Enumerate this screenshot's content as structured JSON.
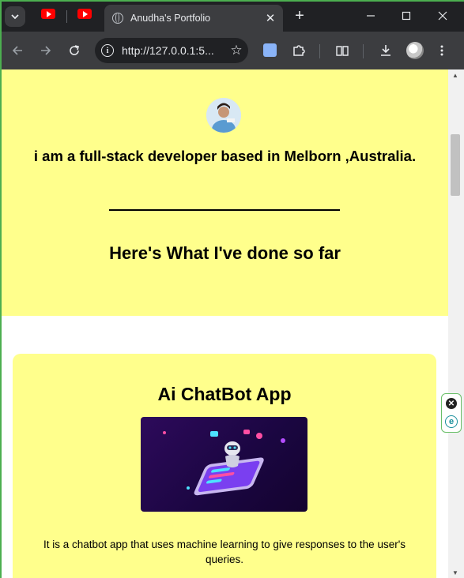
{
  "browser": {
    "active_tab_title": "Anudha's Portfolio",
    "address_url": "http://127.0.0.1:5...",
    "new_tab_symbol": "+",
    "close_symbol": "✕"
  },
  "hero": {
    "intro_text": "i am a full-stack developer based in Melborn ,Australia.",
    "section_heading": "Here's What I've done so far"
  },
  "project": {
    "title": "Ai ChatBot App",
    "description": "It is a chatbot app that uses machine learning to give responses to the user's queries."
  },
  "colors": {
    "hero_background": "#ffff8c",
    "browser_dark": "#202124",
    "toolbar": "#3c3d40"
  }
}
